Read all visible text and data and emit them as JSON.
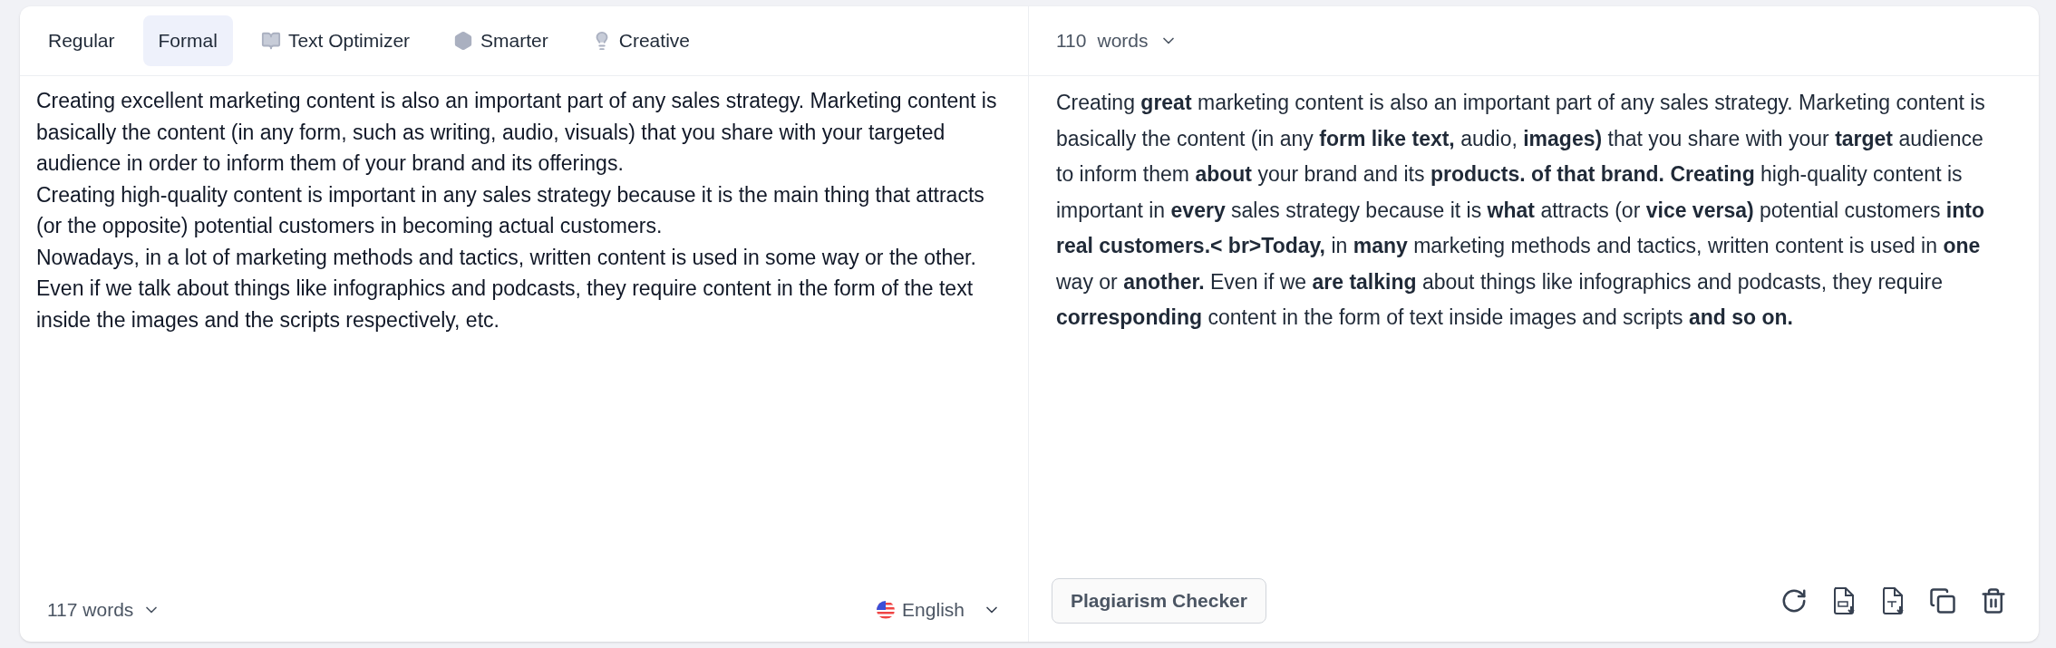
{
  "modes": [
    {
      "label": "Regular",
      "kind": "plain",
      "selected": false
    },
    {
      "label": "Formal",
      "kind": "plain",
      "selected": true
    },
    {
      "label": "Text Optimizer",
      "kind": "book",
      "selected": false
    },
    {
      "label": "Smarter",
      "kind": "hexagon",
      "selected": false
    },
    {
      "label": "Creative",
      "kind": "bulb",
      "selected": false
    }
  ],
  "input": {
    "paragraphs": [
      "Creating excellent marketing content is also an important part of any sales strategy. Marketing content is basically the content (in any form, such as writing, audio, visuals) that you share with your targeted audience in order to inform them of your brand and its offerings.",
      "Creating high-quality content is important in any sales strategy because it is the main thing that attracts (or the opposite) potential customers in becoming actual customers.",
      "Nowadays, in a lot of marketing methods and tactics, written content is used in some way or the other. Even if we talk about things like infographics and podcasts, they require content in the form of the text inside the images and the scripts respectively, etc."
    ],
    "word_count": "117 words",
    "language": "English"
  },
  "output": {
    "count": "110",
    "count_unit": "words",
    "text": "Creating **great** marketing content is also an important part of any sales strategy. Marketing content is basically the content (in any **form like text,** audio, **images)** that you share with your **target** audience to inform them **about** your brand and its **products. of that brand. Creating** high-quality content is important in **every** sales strategy because it is **what** attracts (or **vice versa)** potential customers **into real customers.< br>Today,** in **many** marketing methods and tactics, written content is used in **one** way or **another.** Even if we **are talking** about things like infographics and podcasts, they require **corresponding** content in the form of text inside images and scripts **and so on.**",
    "button": "Plagiarism Checker"
  }
}
